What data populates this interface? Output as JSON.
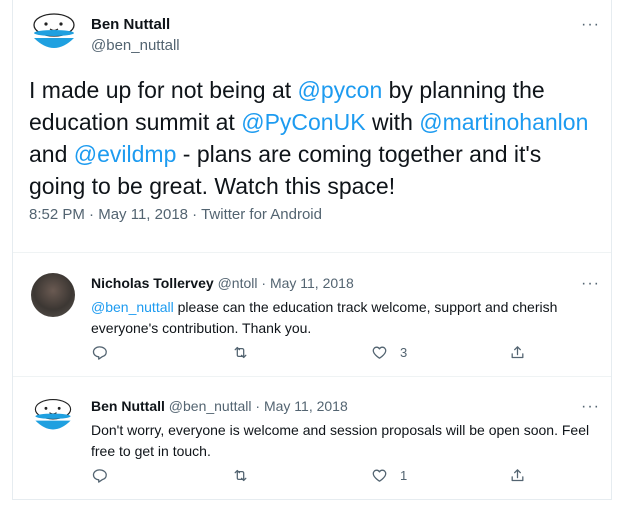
{
  "main_tweet": {
    "author_name": "Ben Nuttall",
    "author_handle": "@ben_nuttall",
    "text_parts": {
      "p1": "I made up for not being at ",
      "m1": "@pycon",
      "p2": " by planning the education summit at ",
      "m2": "@PyConUK",
      "p3": " with ",
      "m3": "@martinohanlon",
      "p4": " and ",
      "m4": "@evildmp",
      "p5": " - plans are coming together and it's going to be great. Watch this space!"
    },
    "time": "8:52 PM",
    "date": "May 11, 2018",
    "source": "Twitter for Android",
    "separator": "·",
    "more": "···"
  },
  "replies": [
    {
      "author_name": "Nicholas Tollervey",
      "author_handle": "@ntoll",
      "date": "May 11, 2018",
      "mention": "@ben_nuttall",
      "text": " please can the education track welcome, support and cherish everyone's contribution. Thank you.",
      "likes": "3",
      "more": "···"
    },
    {
      "author_name": "Ben Nuttall",
      "author_handle": "@ben_nuttall",
      "date": "May 11, 2018",
      "text": "Don't worry, everyone is welcome and session proposals will be open soon. Feel free to get in touch.",
      "likes": "1",
      "more": "···"
    }
  ],
  "colors": {
    "accent": "#1d9bf0",
    "muted": "#536471",
    "text": "#0f1419",
    "avatar_blue": "#1fa0e0"
  },
  "icons": [
    "reply-icon",
    "retweet-icon",
    "like-icon",
    "share-icon",
    "more-icon"
  ]
}
